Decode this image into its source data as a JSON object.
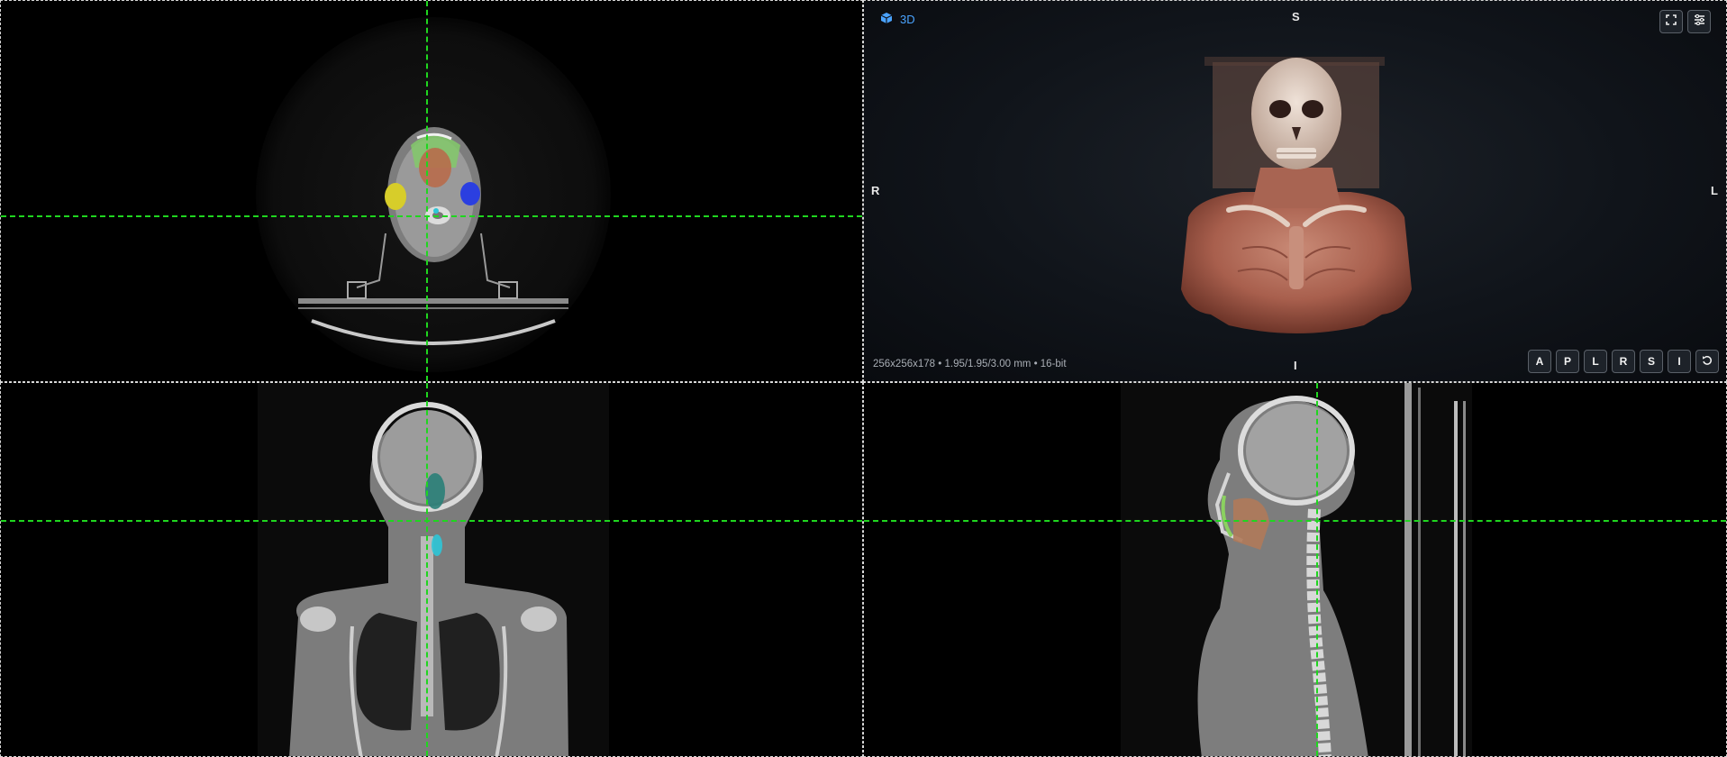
{
  "views": {
    "threeD": {
      "label": "3D",
      "orientation": {
        "top": "S",
        "bottom": "I",
        "left": "R",
        "right": "L"
      },
      "volume_info": "256x256x178 • 1.95/1.95/3.00 mm • 16-bit",
      "view_buttons": [
        "A",
        "P",
        "L",
        "R",
        "S",
        "I"
      ],
      "icons": {
        "label": "cube-icon",
        "fullscreen": "fullscreen-icon",
        "settings": "sliders-icon",
        "reset": "reset-rotation-icon"
      }
    },
    "axial": {
      "name": "axial-slice"
    },
    "coronal": {
      "name": "coronal-slice"
    },
    "sagittal": {
      "name": "sagittal-slice"
    }
  },
  "colors": {
    "crosshair": "#1fd61f",
    "label_accent": "#4aa3ff",
    "pane_border": "#d8d8d8",
    "background": "#000000"
  }
}
